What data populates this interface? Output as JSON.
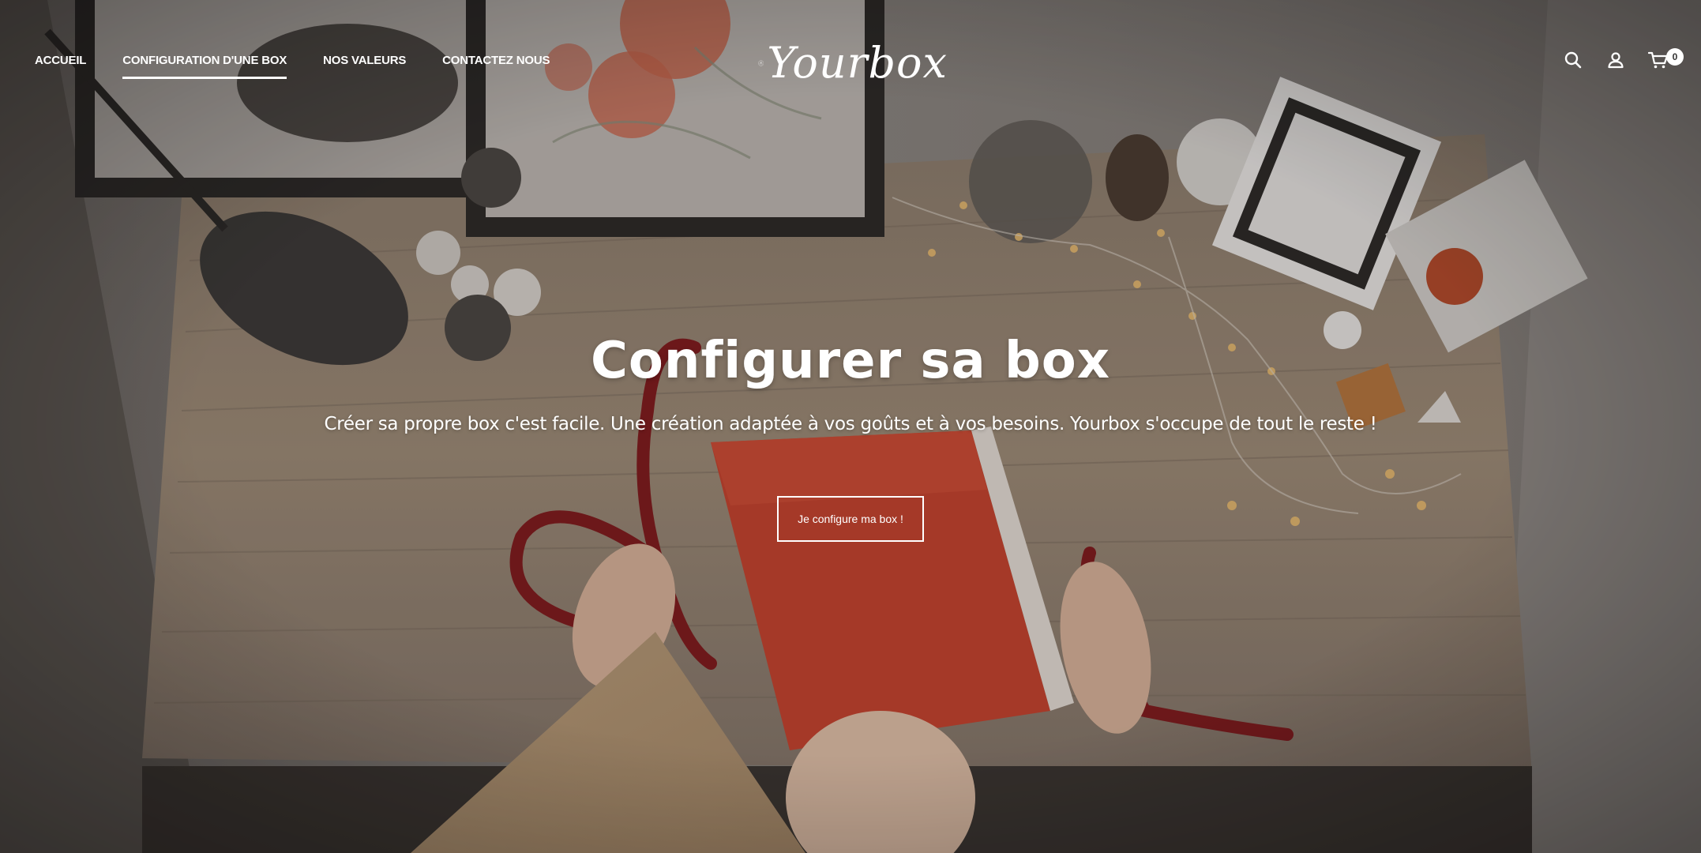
{
  "nav": {
    "items": [
      {
        "label": "ACCUEIL",
        "active": false
      },
      {
        "label": "CONFIGURATION D'UNE BOX",
        "active": true
      },
      {
        "label": "NOS VALEURS",
        "active": false
      },
      {
        "label": "CONTACTEZ NOUS",
        "active": false
      }
    ]
  },
  "brand": {
    "name": "Yourbox",
    "logo_icon": "gift-box-hands-icon"
  },
  "header_icons": {
    "search": "search-icon",
    "account": "user-icon",
    "cart": "cart-icon",
    "cart_count": "0"
  },
  "hero": {
    "title": "Configurer sa box",
    "subtitle": "Créer sa propre box c'est facile. Une création adaptée à vos goûts et à vos besoins. Yourbox s'occupe de tout le reste !",
    "cta_label": "Je configure ma box !"
  },
  "colors": {
    "text": "#ffffff",
    "overlay": "#141210",
    "gift_red": "#d6452f",
    "ribbon": "#8e1a1f",
    "table": "#b3a08a"
  }
}
